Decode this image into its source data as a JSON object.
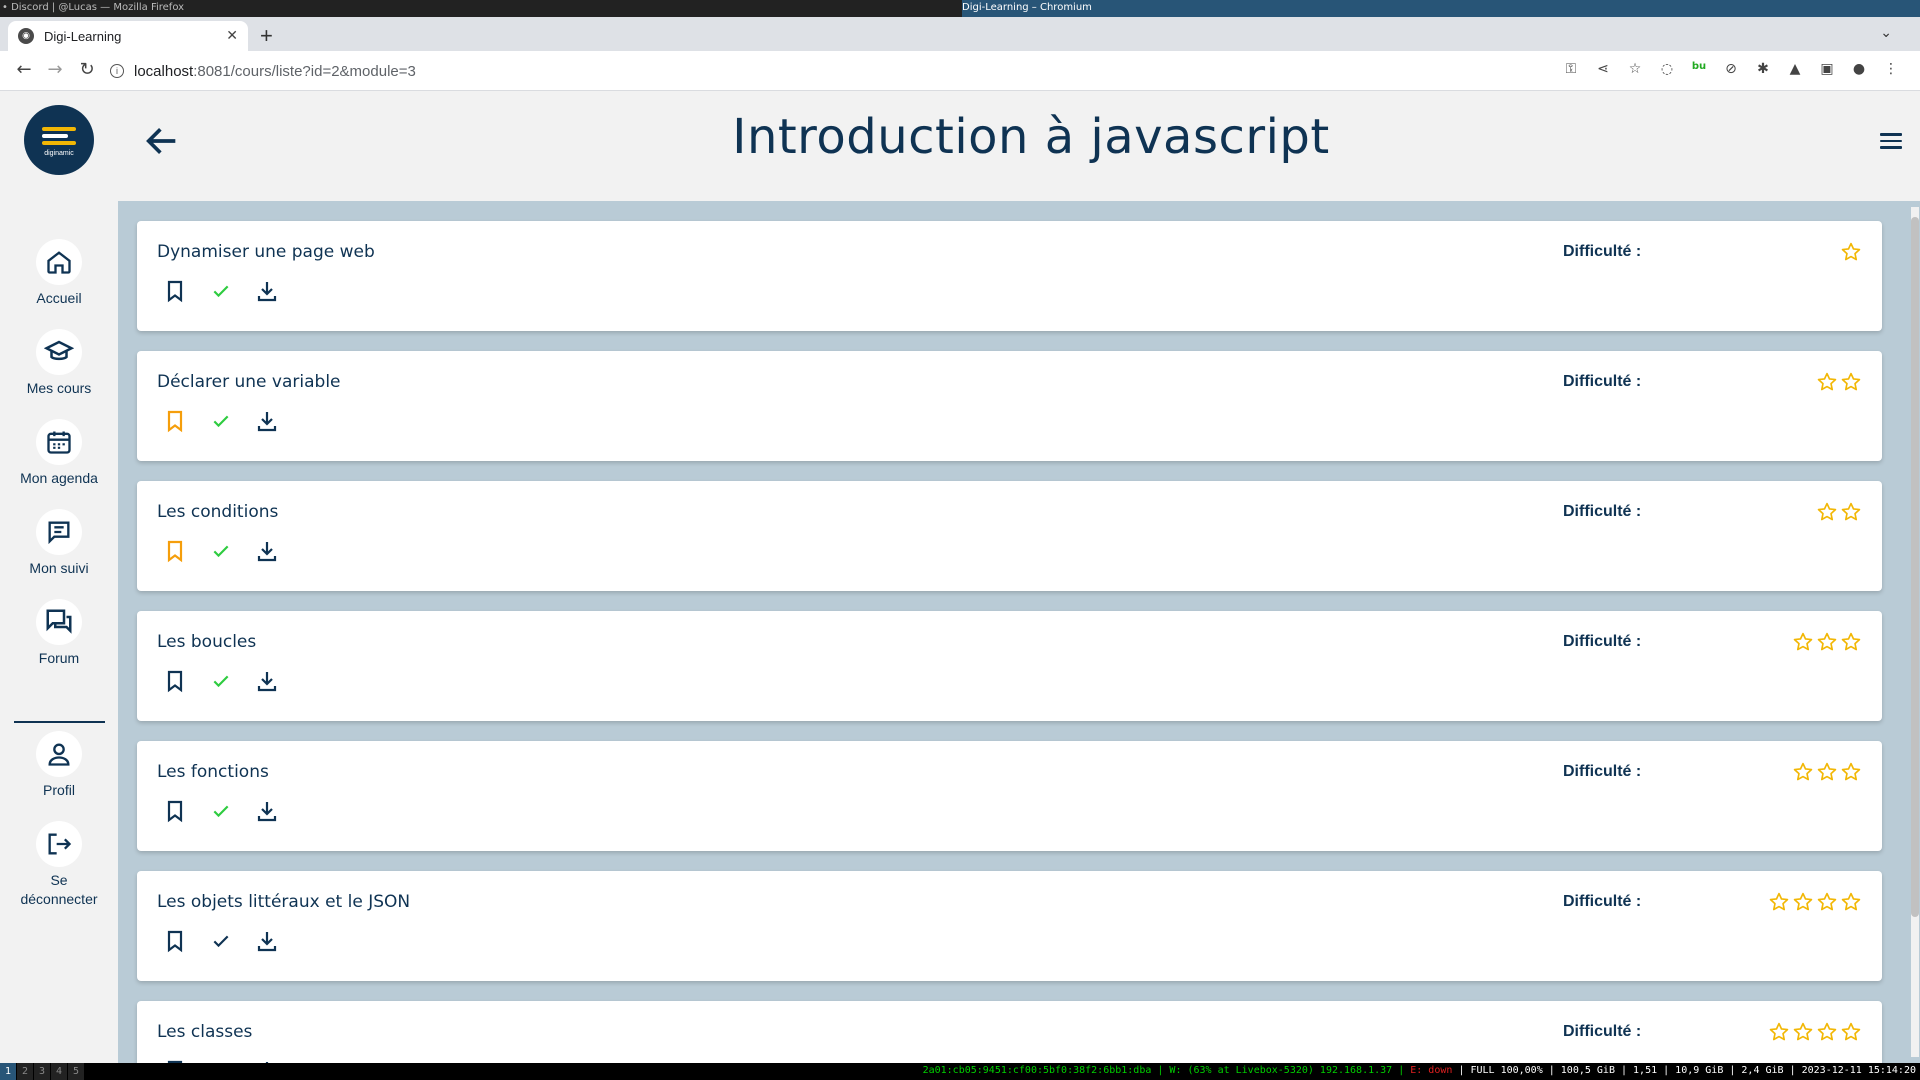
{
  "system_top": {
    "left_text": "• Discord | @Lucas — Mozilla Firefox",
    "center_text": "Digi-Learning – Chromium"
  },
  "browser": {
    "tab_title": "Digi-Learning",
    "url_host": "localhost",
    "url_path": ":8081/cours/liste?id=2&module=3"
  },
  "sidebar": {
    "logo_text": "diginamic",
    "items": [
      {
        "label": "Accueil",
        "icon": "home-icon"
      },
      {
        "label": "Mes cours",
        "icon": "graduation-cap-icon"
      },
      {
        "label": "Mon agenda",
        "icon": "calendar-icon"
      },
      {
        "label": "Mon suivi",
        "icon": "chat-icon"
      },
      {
        "label": "Forum",
        "icon": "forum-icon"
      }
    ],
    "profile": {
      "label": "Profil",
      "icon": "person-icon"
    },
    "logout": {
      "label_line1": "Se",
      "label_line2": "déconnecter",
      "icon": "logout-icon"
    }
  },
  "page": {
    "title": "Introduction à javascript"
  },
  "courses": [
    {
      "title": "Dynamiser une page web",
      "difficulty_label": "Difficulté :",
      "stars": 1,
      "bookmarked": false,
      "done": true
    },
    {
      "title": "Déclarer une variable",
      "difficulty_label": "Difficulté :",
      "stars": 2,
      "bookmarked": true,
      "done": true
    },
    {
      "title": "Les conditions",
      "difficulty_label": "Difficulté :",
      "stars": 2,
      "bookmarked": true,
      "done": true
    },
    {
      "title": "Les boucles",
      "difficulty_label": "Difficulté :",
      "stars": 3,
      "bookmarked": false,
      "done": true
    },
    {
      "title": "Les fonctions",
      "difficulty_label": "Difficulté :",
      "stars": 3,
      "bookmarked": false,
      "done": true
    },
    {
      "title": "Les objets littéraux et le JSON",
      "difficulty_label": "Difficulté :",
      "stars": 4,
      "bookmarked": false,
      "done": false
    },
    {
      "title": "Les classes",
      "difficulty_label": "Difficulté :",
      "stars": 4,
      "bookmarked": false,
      "done": false
    }
  ],
  "colors": {
    "navy": "#0f3353",
    "star": "#f2b705",
    "bookmark_active": "#f59e0b",
    "check_done": "#2ecc40",
    "content_bg": "#b9cbd6"
  },
  "system_bottom": {
    "workspaces": [
      "1",
      "2",
      "3",
      "4",
      "5"
    ],
    "net": "2a01:cb05:9451:cf00:5bf0:38f2:6bb1:dba | W: (63% at Livebox-5320) 192.168.1.37 |",
    "eth": "E: down",
    "rest": "| FULL 100,00% | 100,5 GiB | 1,51 | 10,9 GiB | 2,4 GiB | 2023-12-11 15:14:20"
  }
}
